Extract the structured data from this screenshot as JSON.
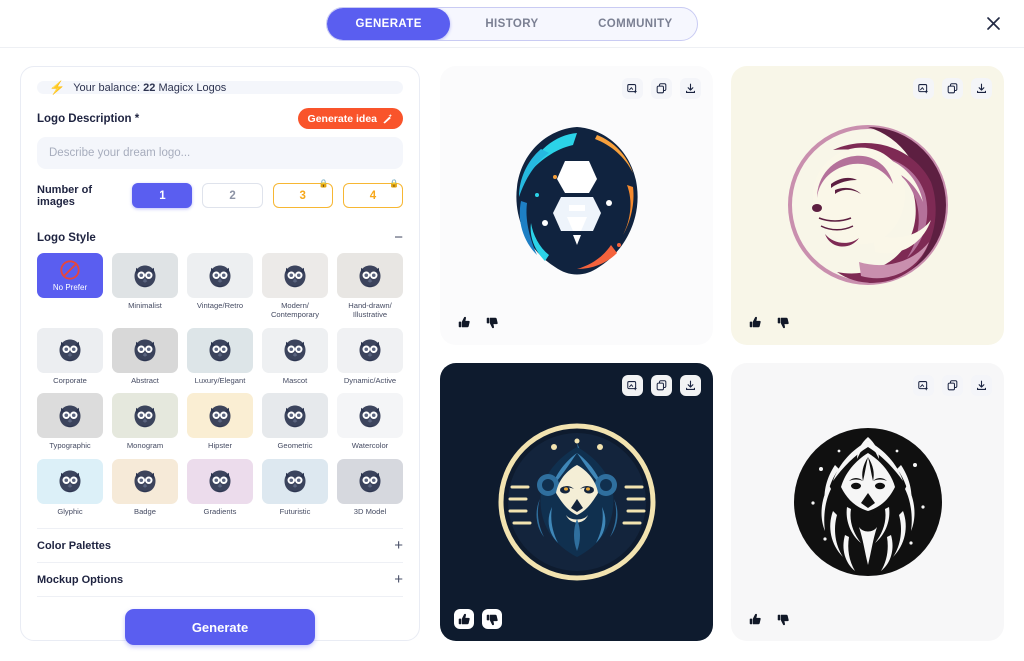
{
  "window": {
    "close_label": "×"
  },
  "tabs": [
    {
      "label": "GENERATE",
      "active": true
    },
    {
      "label": "HISTORY",
      "active": false
    },
    {
      "label": "COMMUNITY",
      "active": false
    }
  ],
  "form": {
    "balance_prefix": "Your balance:",
    "balance_amount": "22",
    "balance_suffix": "Magicx Logos",
    "description_label": "Logo Description *",
    "generate_idea_label": "Generate idea",
    "description_placeholder": "Describe your dream logo...",
    "number_label": "Number of images",
    "number_options": [
      {
        "value": "1",
        "selected": true,
        "locked": false
      },
      {
        "value": "2",
        "selected": false,
        "locked": false
      },
      {
        "value": "3",
        "selected": false,
        "locked": true
      },
      {
        "value": "4",
        "selected": false,
        "locked": true
      }
    ],
    "style_section_title": "Logo Style",
    "style_section_toggle": "−",
    "styles": [
      {
        "label": "No Prefer",
        "selected": true,
        "bg": "#5a5ef0"
      },
      {
        "label": "Minimalist",
        "selected": false,
        "bg": "#dfe3e5"
      },
      {
        "label": "Vintage/Retro",
        "selected": false,
        "bg": "#edeff1"
      },
      {
        "label": "Modern/\nContemporary",
        "selected": false,
        "bg": "#eceae8"
      },
      {
        "label": "Hand-drawn/\nIllustrative",
        "selected": false,
        "bg": "#e8e6e3"
      },
      {
        "label": "Corporate",
        "selected": false,
        "bg": "#eceef1"
      },
      {
        "label": "Abstract",
        "selected": false,
        "bg": "#d8d8d8"
      },
      {
        "label": "Luxury/Elegant",
        "selected": false,
        "bg": "#dde5e8"
      },
      {
        "label": "Mascot",
        "selected": false,
        "bg": "#eef0f2"
      },
      {
        "label": "Dynamic/Active",
        "selected": false,
        "bg": "#f0f1f3"
      },
      {
        "label": "Typographic",
        "selected": false,
        "bg": "#dcdcdc"
      },
      {
        "label": "Monogram",
        "selected": false,
        "bg": "#e5e8dd"
      },
      {
        "label": "Hipster",
        "selected": false,
        "bg": "#faeed3"
      },
      {
        "label": "Geometric",
        "selected": false,
        "bg": "#e6e9ec"
      },
      {
        "label": "Watercolor",
        "selected": false,
        "bg": "#f4f5f7"
      },
      {
        "label": "Glyphic",
        "selected": false,
        "bg": "#dcf0f8"
      },
      {
        "label": "Badge",
        "selected": false,
        "bg": "#f6ead8"
      },
      {
        "label": "Gradients",
        "selected": false,
        "bg": "#ecdcec"
      },
      {
        "label": "Futuristic",
        "selected": false,
        "bg": "#dde8f0"
      },
      {
        "label": "3D Model",
        "selected": false,
        "bg": "#d6d8de"
      }
    ],
    "accordions": [
      {
        "title": "Color Palettes",
        "toggle": "+"
      },
      {
        "title": "Mockup Options",
        "toggle": "+"
      }
    ],
    "generate_button": "Generate"
  },
  "results": {
    "action_icons": [
      "image-variations-icon",
      "copy-icon",
      "download-icon"
    ],
    "vote_icons": [
      "thumbs-up-icon",
      "thumbs-down-icon"
    ],
    "cards": [
      {
        "name": "colorful-lion-logo",
        "background": "#fbfbfc",
        "theme": "light"
      },
      {
        "name": "purple-lion-logo",
        "background": "#f8f6e8",
        "theme": "light"
      },
      {
        "name": "blue-gold-lion-logo",
        "background": "#0e1b2e",
        "theme": "dark"
      },
      {
        "name": "monochrome-lion-logo",
        "background": "#f7f7f8",
        "theme": "light"
      }
    ]
  },
  "colors": {
    "accent": "#5a5ef0",
    "danger": "#f9542b",
    "locked": "#f7a81b"
  }
}
